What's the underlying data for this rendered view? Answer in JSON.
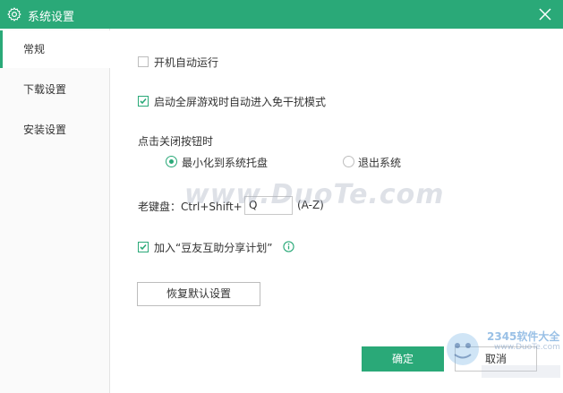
{
  "window": {
    "title": "系统设置",
    "accent_color": "#2aa978",
    "icons": {
      "title": "gear-icon",
      "close": "close-icon"
    }
  },
  "sidebar": {
    "items": [
      {
        "label": "常规",
        "active": true
      },
      {
        "label": "下载设置",
        "active": false
      },
      {
        "label": "安装设置",
        "active": false
      }
    ]
  },
  "general": {
    "autostart": {
      "label": "开机自动运行",
      "checked": false
    },
    "fullscreen_game": {
      "label": "启动全屏游戏时自动进入免干扰模式",
      "checked": true
    },
    "close_button": {
      "heading": "点击关闭按钮时",
      "options": [
        {
          "label": "最小化到系统托盘",
          "selected": true
        },
        {
          "label": "退出系统",
          "selected": false
        }
      ]
    },
    "boss_key": {
      "label": "老键盘：Ctrl+Shift+",
      "value": "Q",
      "range": "(A-Z)"
    },
    "share_plan": {
      "label": "加入“豆友互助分享计划”",
      "checked": true,
      "info_icon": "info-icon"
    }
  },
  "buttons": {
    "restore": "恢复默认设置",
    "ok": "确定",
    "cancel": "取消"
  },
  "watermarks": {
    "duote": "www.DuoTe.com",
    "site_logo": "2345软件大全",
    "site_url": "www.DuoTe.com"
  }
}
